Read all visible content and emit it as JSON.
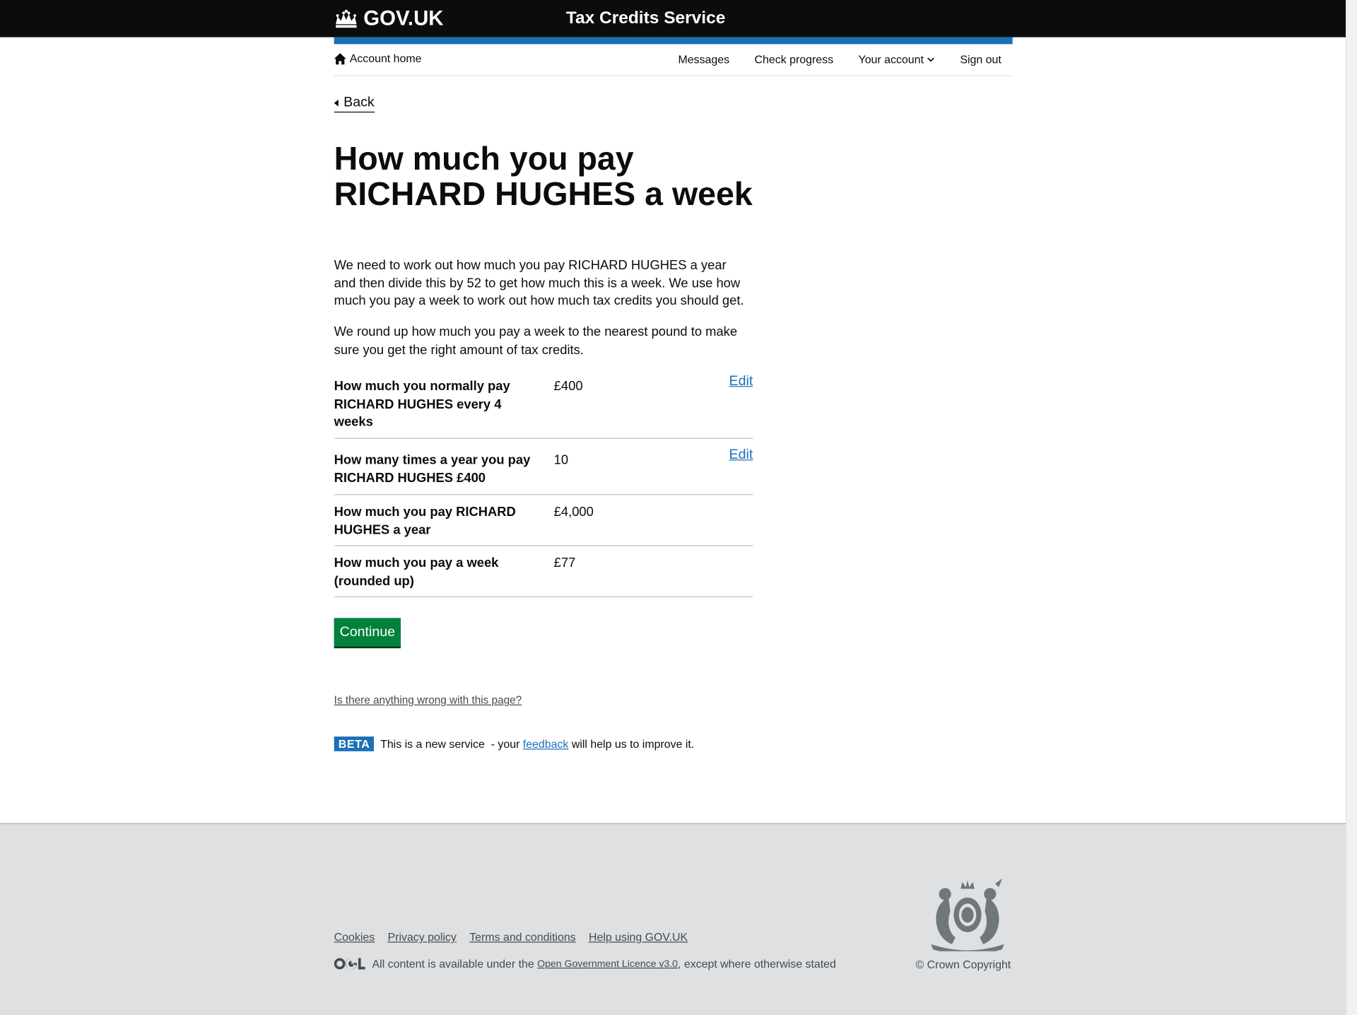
{
  "header": {
    "logo_text": "GOV.UK",
    "service_name": "Tax Credits Service",
    "bar_color": "#1d70b8"
  },
  "account_nav": {
    "home": "Account home",
    "items": [
      "Messages",
      "Check progress",
      "Your account",
      "Sign out"
    ]
  },
  "back_link": "Back",
  "title": "How much you pay RICHARD HUGHES a week",
  "paragraphs": [
    "We need to work out how much you pay RICHARD HUGHES a year and then divide this by 52 to get how much this is a week. We use how much you pay a week to work out how much tax credits you should get.",
    "We round up how much you pay a week to the nearest pound to make sure you get the right amount of tax credits."
  ],
  "summary": [
    {
      "key": "How much you normally pay RICHARD HUGHES every 4 weeks",
      "value": "£400",
      "action": "Edit"
    },
    {
      "key": "How many times a year you pay RICHARD HUGHES £400",
      "value": "10",
      "action": "Edit"
    },
    {
      "key": "How much you pay RICHARD HUGHES a year",
      "value": "£4,000"
    },
    {
      "key": "How much you pay a week (rounded up)",
      "value": "£77"
    }
  ],
  "continue_label": "Continue",
  "report_link": "Is there anything wrong with this page?",
  "beta": {
    "tag": "BETA",
    "text_before": "This is a new service  - your ",
    "link": "feedback",
    "text_after": " will help us to improve it."
  },
  "footer": {
    "links": [
      "Cookies",
      "Privacy policy",
      "Terms and conditions",
      "Help using GOV.UK"
    ],
    "licence_before": "All content is available under the ",
    "licence_link": "Open Government Licence v3.0",
    "licence_after": ", except where otherwise stated",
    "copyright": "© Crown Copyright"
  },
  "colors": {
    "accent": "#1d70b8",
    "button": "#00823b",
    "header_bg": "#0b0c0c",
    "footer_bg": "#dee0e2"
  }
}
